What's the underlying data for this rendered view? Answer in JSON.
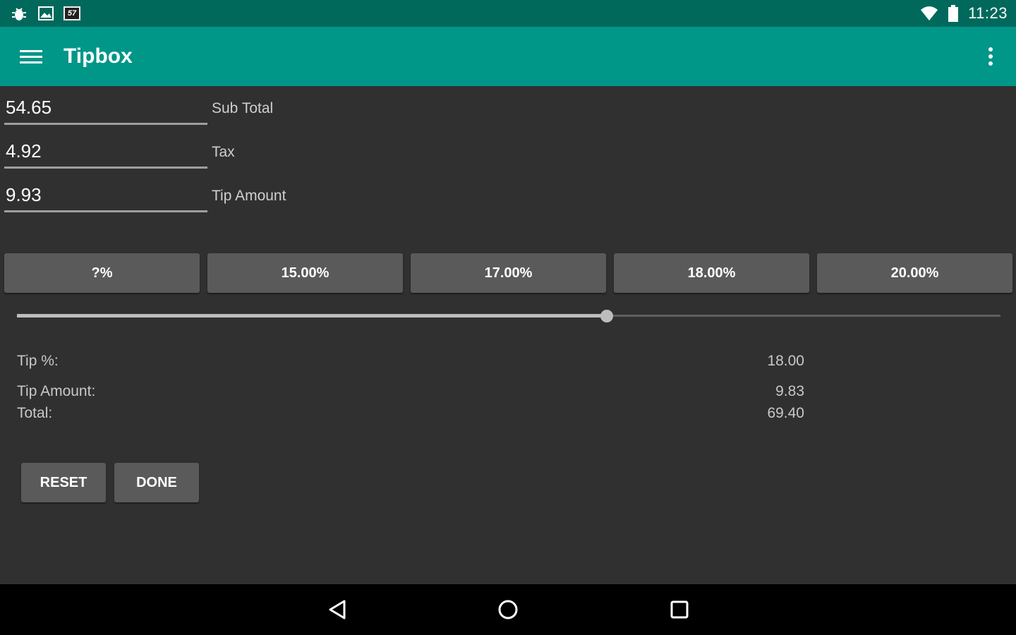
{
  "status_bar": {
    "time": "11:23",
    "notification_badge": "57",
    "icons": [
      "bug-icon",
      "image-icon",
      "notification-badge",
      "wifi-icon",
      "battery-icon"
    ]
  },
  "app_bar": {
    "title": "Tipbox",
    "menu_icon": "hamburger-menu-icon",
    "overflow_icon": "more-vert-icon"
  },
  "fields": [
    {
      "value": "54.65",
      "label": "Sub Total"
    },
    {
      "value": "4.92",
      "label": "Tax"
    },
    {
      "value": "9.93",
      "label": "Tip Amount"
    }
  ],
  "percent_buttons": [
    "?%",
    "15.00%",
    "17.00%",
    "18.00%",
    "20.00%"
  ],
  "slider": {
    "fraction": 0.6
  },
  "summary": {
    "tip_pct_label": "Tip %:",
    "tip_pct_value": "18.00",
    "tip_amount_label": "Tip Amount:",
    "tip_amount_value": "9.83",
    "total_label": "Total:",
    "total_value": "69.40"
  },
  "actions": {
    "reset_label": "RESET",
    "done_label": "DONE"
  },
  "nav_bar": {
    "icons": [
      "back-icon",
      "home-icon",
      "recents-icon"
    ]
  },
  "colors": {
    "status_bar": "#00695c",
    "app_bar": "#009688",
    "background": "#303030",
    "button": "#5a5a5a"
  }
}
